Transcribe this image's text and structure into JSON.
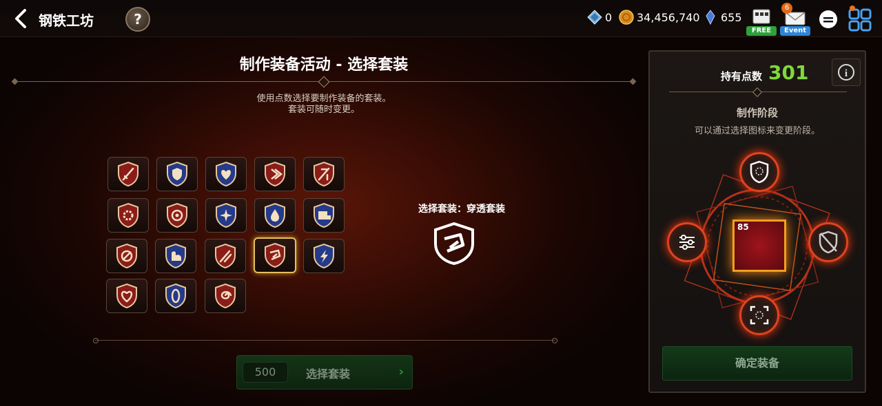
{
  "header": {
    "title": "钢铁工坊",
    "help_label": "?",
    "currencies": [
      {
        "name": "diamond",
        "value": "0"
      },
      {
        "name": "gold",
        "value": "34,456,740"
      },
      {
        "name": "crystal",
        "value": "655"
      }
    ],
    "free_label": "FREE",
    "event_label": "Event",
    "event_count": "6"
  },
  "main": {
    "title": "制作装备活动 - 选择套装",
    "desc_line1": "使用点数选择要制作装备的套装。",
    "desc_line2": "套装可随时变更。",
    "selected_label": "选择套装：穿透套装",
    "button": {
      "cost": "500",
      "label": "选择套装",
      "arrow": "›"
    }
  },
  "panel": {
    "points_label": "持有点数",
    "points_value": "301",
    "info_label": "i",
    "stage_title": "制作阶段",
    "stage_desc": "可以通过选择图标来变更阶段。",
    "item_level": "85",
    "confirm_label": "确定装备"
  },
  "colors": {
    "accent_green": "#7fd93a",
    "selected_border": "#e6c060",
    "node_glow": "#e04420"
  }
}
